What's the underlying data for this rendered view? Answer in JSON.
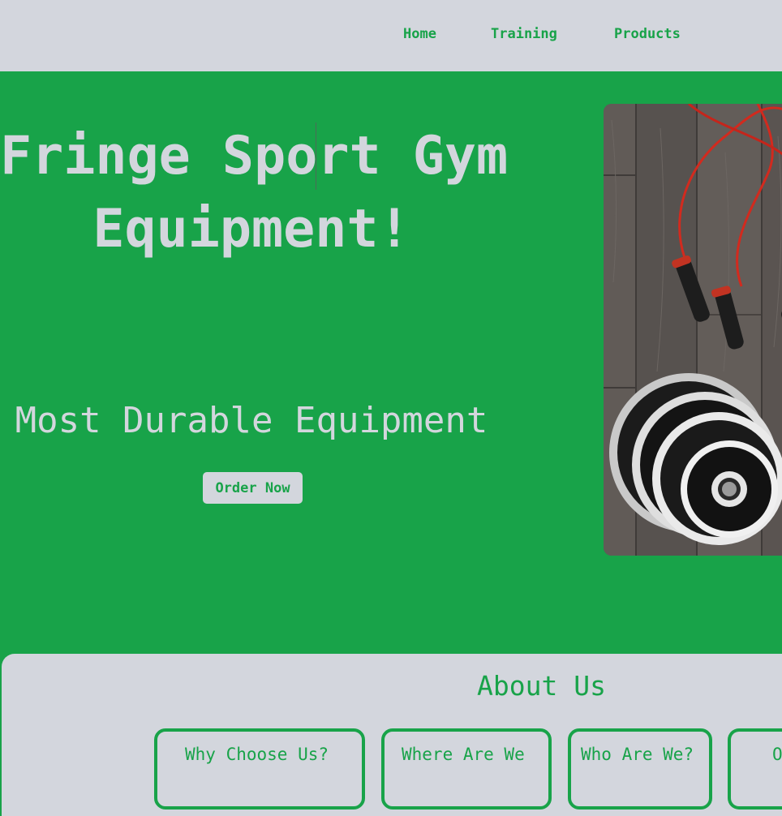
{
  "nav": {
    "items": [
      {
        "label": "Home"
      },
      {
        "label": "Training"
      },
      {
        "label": "Products"
      }
    ]
  },
  "hero": {
    "title_line1": "Fringe Sport Gym",
    "title_line2": "Equipment!",
    "subtitle": "Most Durable Equipment",
    "order_button": "Order Now",
    "image_icon": "jump-rope-and-weight-plates-photo"
  },
  "about": {
    "title": "About Us",
    "cards": [
      {
        "label": "Why Choose Us?"
      },
      {
        "label": "Where Are We"
      },
      {
        "label": "Who Are We?"
      },
      {
        "label": "O"
      }
    ]
  },
  "colors": {
    "brand_green": "#18a349",
    "light_gray": "#d3d6dd"
  }
}
